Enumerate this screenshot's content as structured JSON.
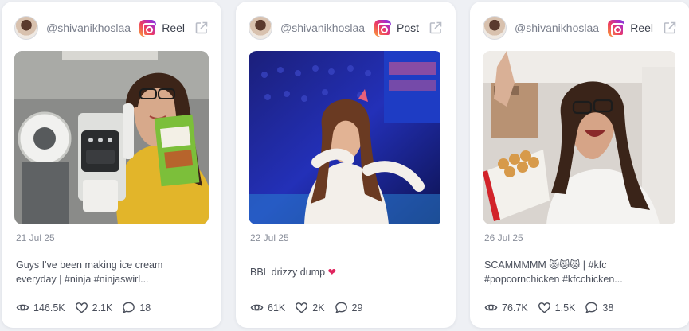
{
  "colors": {
    "background": "#eef0f4",
    "card": "#ffffff",
    "text": "#3a3f4b",
    "muted": "#8a8f9b",
    "heart_emoji": "#e0245e"
  },
  "cards": [
    {
      "handle": "@shivanikhoslaa",
      "platform_icon": "instagram-icon",
      "post_type": "Reel",
      "date": "21 Jul 25",
      "caption_line1": "Guys I've been making ice cream",
      "caption_line2": "everyday | #ninja #ninjaswirl...",
      "views": "146.5K",
      "likes": "2.1K",
      "comments": "18"
    },
    {
      "handle": "@shivanikhoslaa",
      "platform_icon": "instagram-icon",
      "post_type": "Post",
      "date": "22 Jul 25",
      "caption_line1": "BBL drizzy dump",
      "caption_emoji": "❤",
      "views": "61K",
      "likes": "2K",
      "comments": "29"
    },
    {
      "handle": "@shivanikhoslaa",
      "platform_icon": "instagram-icon",
      "post_type": "Reel",
      "date": "26 Jul 25",
      "caption_line1": "SCAMMMMM 😻😻😻 | #kfc",
      "caption_line2": "#popcornchicken #kfcchicken...",
      "views": "76.7K",
      "likes": "1.5K",
      "comments": "38"
    }
  ]
}
